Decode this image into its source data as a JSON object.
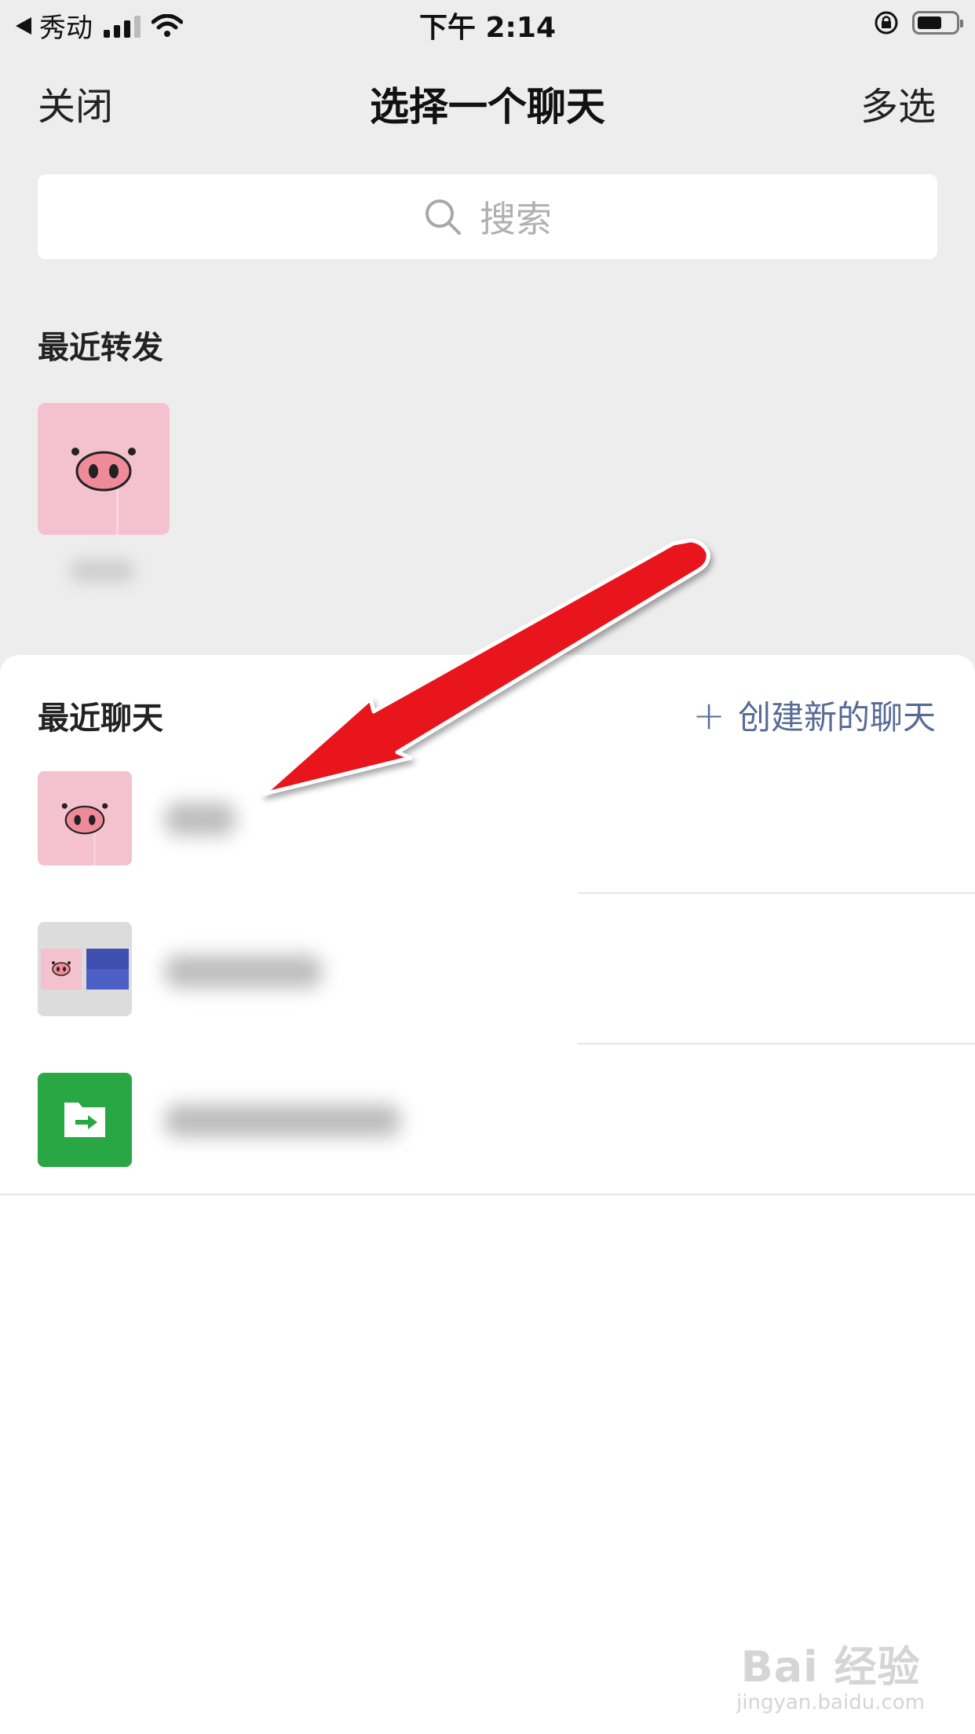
{
  "status_bar": {
    "back_app": "秀动",
    "time": "下午 2:14"
  },
  "nav": {
    "close_label": "关闭",
    "title": "选择一个聊天",
    "multi_select_label": "多选"
  },
  "search": {
    "placeholder": "搜索"
  },
  "recent_forward": {
    "title": "最近转发"
  },
  "recent_chats": {
    "title": "最近聊天",
    "create_label": "创建新的聊天"
  },
  "watermark": {
    "logo": "Bai 经验",
    "url": "jingyan.baidu.com"
  },
  "colors": {
    "accent_link": "#576b95",
    "arrow": "#e8141b",
    "pig_pink": "#f4c2cf",
    "folder_green": "#2aa745"
  },
  "icons": [
    "back-triangle-icon",
    "signal-icon",
    "wifi-icon",
    "rotation-lock-icon",
    "battery-icon",
    "search-icon",
    "plus-icon",
    "pig-avatar-icon",
    "file-transfer-icon",
    "annotation-arrow"
  ]
}
